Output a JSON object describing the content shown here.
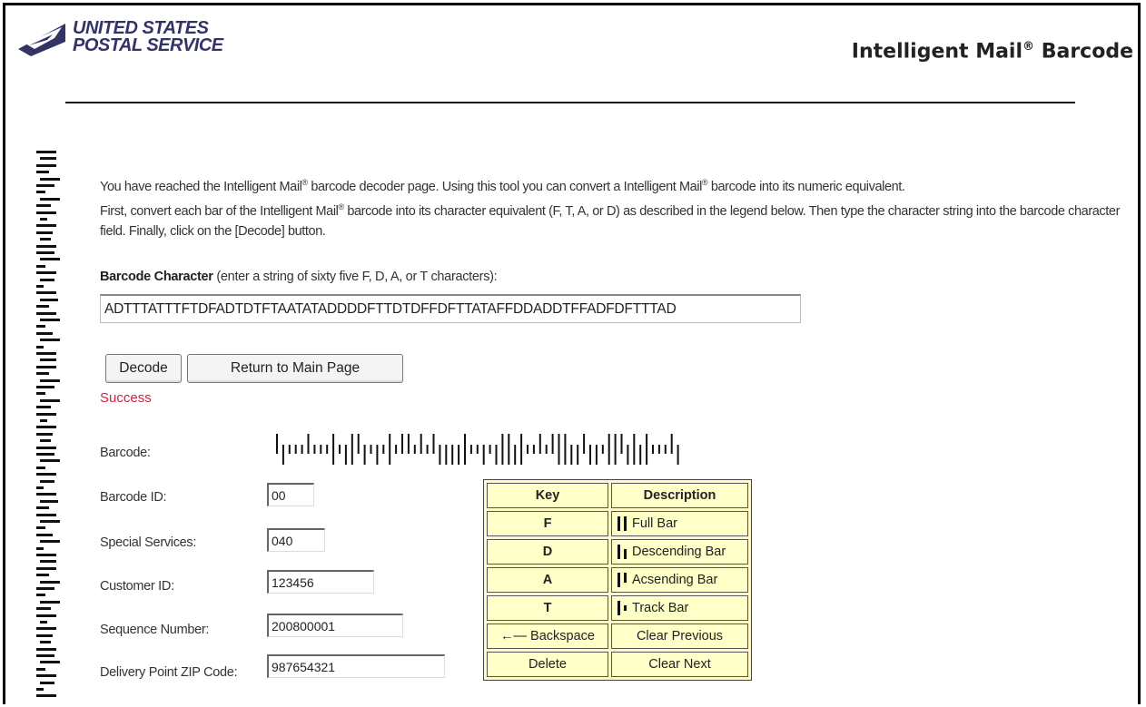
{
  "header": {
    "logo_line1": "UNITED STATES",
    "logo_line2": "POSTAL SERVICE",
    "title": "Intelligent Mail",
    "title_mark": "®",
    "title_suffix": "Barcode"
  },
  "intro": {
    "p1a": "You have reached the Intelligent Mail",
    "p1b": " barcode decoder page. Using this tool you can convert a Intelligent Mail",
    "p1c": " barcode into its numeric equivalent.",
    "p2a": "First, convert each bar of the Intelligent Mail",
    "p2b": " barcode into its character equivalent (F, T, A, or D) as described in the legend below. Then type the character string into the barcode character field. Finally, click on the [Decode] button.",
    "reg": "®"
  },
  "barcode_character": {
    "label": "Barcode Character",
    "hint": " (enter a string of sixty five F, D, A, or T characters):",
    "value": "ADTTTATTTFTDFADTDTFTAATATADDDDFTTDTDFFDFTTATAFFDDADDTFFADFDFTTTAD"
  },
  "buttons": {
    "decode": "Decode",
    "return": "Return to Main Page"
  },
  "status": "Success",
  "fields": {
    "barcode_label": "Barcode:",
    "barcode_id_label": "Barcode ID:",
    "barcode_id": "00",
    "special_services_label": "Special Services:",
    "special_services": "040",
    "customer_id_label": "Customer ID:",
    "customer_id": "123456",
    "sequence_number_label": "Sequence Number:",
    "sequence_number": "200800001",
    "zip_label": "Delivery Point ZIP Code:",
    "zip": "987654321"
  },
  "legend": {
    "key_header": "Key",
    "desc_header": "Description",
    "rows": [
      {
        "key": "F",
        "desc": "Full Bar"
      },
      {
        "key": "D",
        "desc": "Descending Bar"
      },
      {
        "key": "A",
        "desc": "Acsending Bar"
      },
      {
        "key": "T",
        "desc": "Track Bar"
      }
    ],
    "backspace": "Backspace",
    "clear_previous": "Clear Previous",
    "delete": "Delete",
    "clear_next": "Clear Next"
  },
  "colors": {
    "status": "#cc2244",
    "legend_bg": "#ffffc8",
    "logo_blue": "#333366"
  }
}
